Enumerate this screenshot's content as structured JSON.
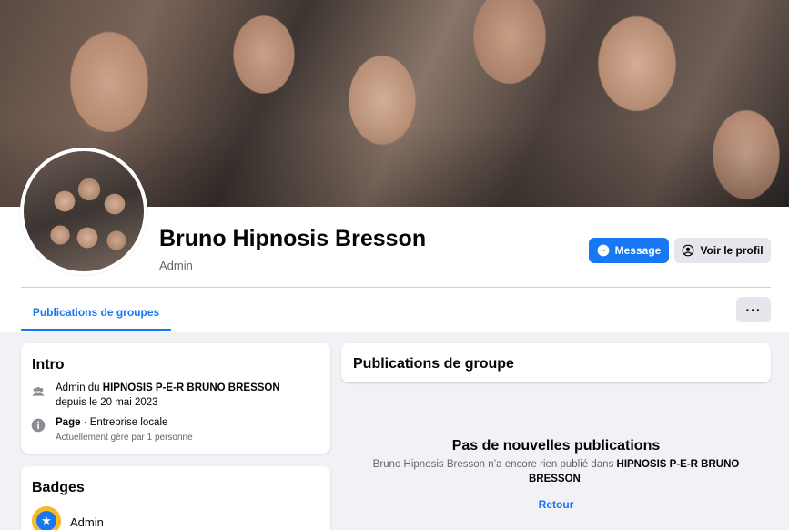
{
  "profile": {
    "name": "Bruno Hipnosis Bresson",
    "role": "Admin"
  },
  "actions": {
    "message_label": "Message",
    "profile_label": "Voir le profil",
    "more_label": "···"
  },
  "tabs": [
    {
      "label": "Publications de groupes",
      "active": true
    }
  ],
  "intro": {
    "title": "Intro",
    "admin_prefix": "Admin du ",
    "group_name": "HIPNOSIS P-E-R BRUNO BRESSON",
    "admin_since": "depuis le 20 mai 2023",
    "page_label": "Page",
    "page_separator": " · ",
    "page_category": "Entreprise locale",
    "managed_by": "Actuellement géré par 1 personne"
  },
  "badges": {
    "title": "Badges",
    "items": [
      {
        "label": "Admin",
        "icon": "star-badge-icon"
      }
    ]
  },
  "group_posts": {
    "title": "Publications de groupe",
    "empty_title": "Pas de nouvelles publications",
    "empty_desc_prefix": "Bruno Hipnosis Bresson n’a encore rien publié dans ",
    "empty_desc_group": "HIPNOSIS P-E-R BRUNO BRESSON",
    "empty_desc_suffix": ".",
    "back_label": "Retour"
  },
  "colors": {
    "accent": "#1877f2",
    "background": "#f0f2f5",
    "secondary_text": "#65676b",
    "badge_gold": "#f7b928"
  }
}
